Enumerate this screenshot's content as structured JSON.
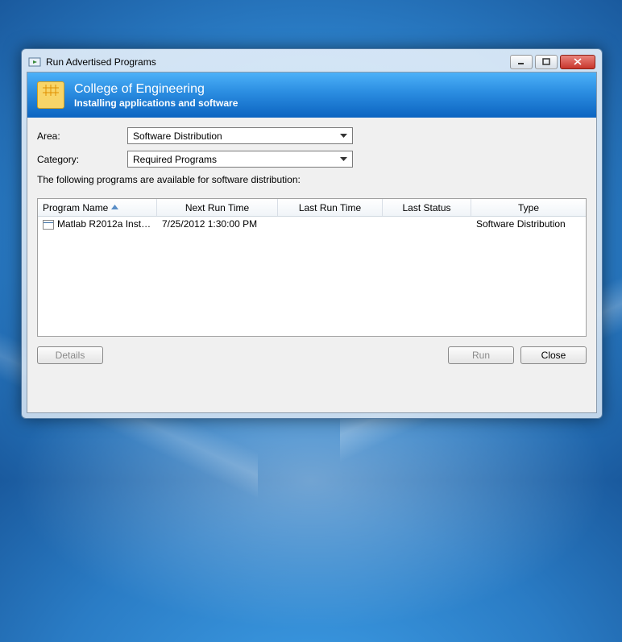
{
  "window": {
    "title": "Run Advertised Programs"
  },
  "banner": {
    "title": "College of Engineering",
    "subtitle": "Installing applications and software"
  },
  "form": {
    "area_label": "Area:",
    "area_value": "Software Distribution",
    "category_label": "Category:",
    "category_value": "Required Programs",
    "info_text": "The following programs are available for software distribution:"
  },
  "list": {
    "columns": {
      "program_name": "Program Name",
      "next_run": "Next Run Time",
      "last_run": "Last Run Time",
      "last_status": "Last Status",
      "type": "Type"
    },
    "rows": [
      {
        "program_name": "Matlab R2012a Install ...",
        "next_run": "7/25/2012 1:30:00 PM",
        "last_run": "",
        "last_status": "",
        "type": "Software Distribution"
      }
    ]
  },
  "buttons": {
    "details": "Details",
    "run": "Run",
    "close": "Close"
  }
}
